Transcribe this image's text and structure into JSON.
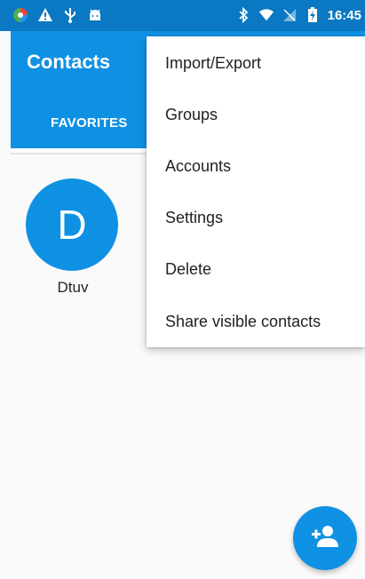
{
  "status_bar": {
    "time": "16:45",
    "left_icons": [
      "app-logo-icon",
      "warning-icon",
      "usb-icon",
      "android-icon"
    ],
    "right_icons": [
      "bluetooth-icon",
      "wifi-icon",
      "signal-icon",
      "battery-charging-icon"
    ]
  },
  "app_bar": {
    "title": "Contacts",
    "tabs": [
      {
        "label": "FAVORITES",
        "selected": true
      }
    ]
  },
  "favorites": [
    {
      "initial": "D",
      "name": "Dtuv"
    }
  ],
  "menu": {
    "items": [
      {
        "label": "Import/Export"
      },
      {
        "label": "Groups"
      },
      {
        "label": "Accounts"
      },
      {
        "label": "Settings"
      },
      {
        "label": "Delete"
      },
      {
        "label": "Share visible contacts"
      }
    ]
  },
  "fab": {
    "icon": "add-contact-icon"
  },
  "colors": {
    "accent": "#0f91e3",
    "status_bar": "#0a78c2"
  }
}
